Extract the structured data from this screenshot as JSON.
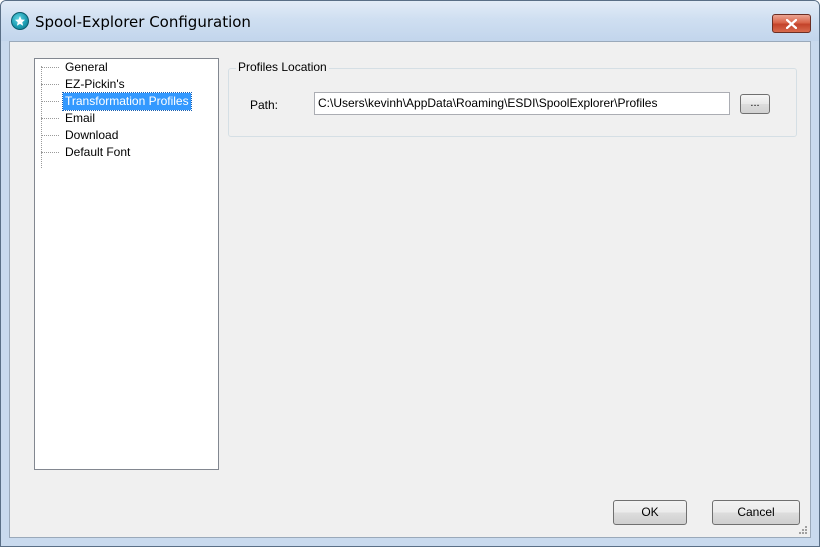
{
  "window": {
    "title": "Spool-Explorer Configuration"
  },
  "tree": {
    "items": [
      {
        "label": "General",
        "selected": false
      },
      {
        "label": "EZ-Pickin's",
        "selected": false
      },
      {
        "label": "Transformation Profiles",
        "selected": true
      },
      {
        "label": "Email",
        "selected": false
      },
      {
        "label": "Download",
        "selected": false
      },
      {
        "label": "Default Font",
        "selected": false
      }
    ]
  },
  "profiles_location": {
    "group_title": "Profiles Location",
    "path_label": "Path:",
    "path_value": "C:\\Users\\kevinh\\AppData\\Roaming\\ESDI\\SpoolExplorer\\Profiles",
    "browse_label": "..."
  },
  "buttons": {
    "ok_label": "OK",
    "cancel_label": "Cancel"
  },
  "colors": {
    "selection": "#3399ff",
    "titlebar": "#c9daee",
    "close_button": "#c3432a"
  }
}
